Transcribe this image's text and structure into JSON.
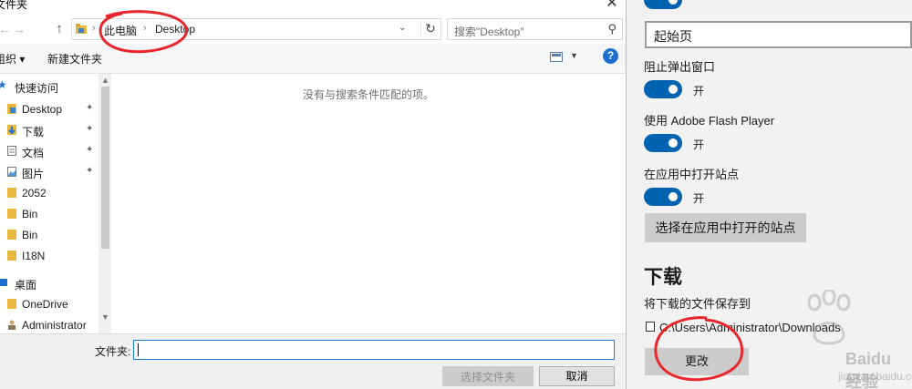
{
  "dialog": {
    "title": "文件夹",
    "close_glyph": "✕",
    "address": {
      "part1": "此电脑",
      "part2": "Desktop",
      "separator": "›"
    },
    "search_placeholder": "搜索\"Desktop\"",
    "toolbar": {
      "organize": "组织 ▾",
      "new_folder": "新建文件夹"
    },
    "nav": {
      "items": [
        {
          "label": "快速访问",
          "icon": "star-icon"
        },
        {
          "label": "Desktop",
          "icon": "folder-icon",
          "pinned": true
        },
        {
          "label": "下载",
          "icon": "download-icon",
          "pinned": true
        },
        {
          "label": "文档",
          "icon": "document-icon",
          "pinned": true
        },
        {
          "label": "图片",
          "icon": "picture-icon",
          "pinned": true
        },
        {
          "label": "2052",
          "icon": "folder-icon"
        },
        {
          "label": "Bin",
          "icon": "folder-icon"
        },
        {
          "label": "Bin",
          "icon": "folder-icon"
        },
        {
          "label": "I18N",
          "icon": "folder-icon"
        },
        {
          "label": "桌面",
          "icon": "desktop-icon"
        },
        {
          "label": "OneDrive",
          "icon": "folder-icon"
        },
        {
          "label": "Administrator",
          "icon": "user-icon"
        }
      ],
      "pin_glyph": "📌"
    },
    "empty_message": "没有与搜索条件匹配的项。",
    "folder_label": "文件夹:",
    "folder_value": "",
    "select_folder_button": "选择文件夹",
    "cancel_button": "取消"
  },
  "settings": {
    "start_page_value": "起始页",
    "block_popups_label": "阻止弹出窗口",
    "block_popups_state": "开",
    "flash_label": "使用 Adobe Flash Player",
    "flash_state": "开",
    "open_in_app_label": "在应用中打开站点",
    "open_in_app_state": "开",
    "choose_sites_button": "选择在应用中打开的站点",
    "download_heading": "下载",
    "save_to_label": "将下载的文件保存到",
    "download_path": "C:\\Users\\Administrator\\Downloads",
    "change_button": "更改"
  },
  "watermark": {
    "brand": "Baidu 经验",
    "url": "jingyan.baidu.com"
  },
  "colors": {
    "accent": "#0063b1",
    "annotation": "#e8262b",
    "help_blue": "#1c6fd0"
  }
}
